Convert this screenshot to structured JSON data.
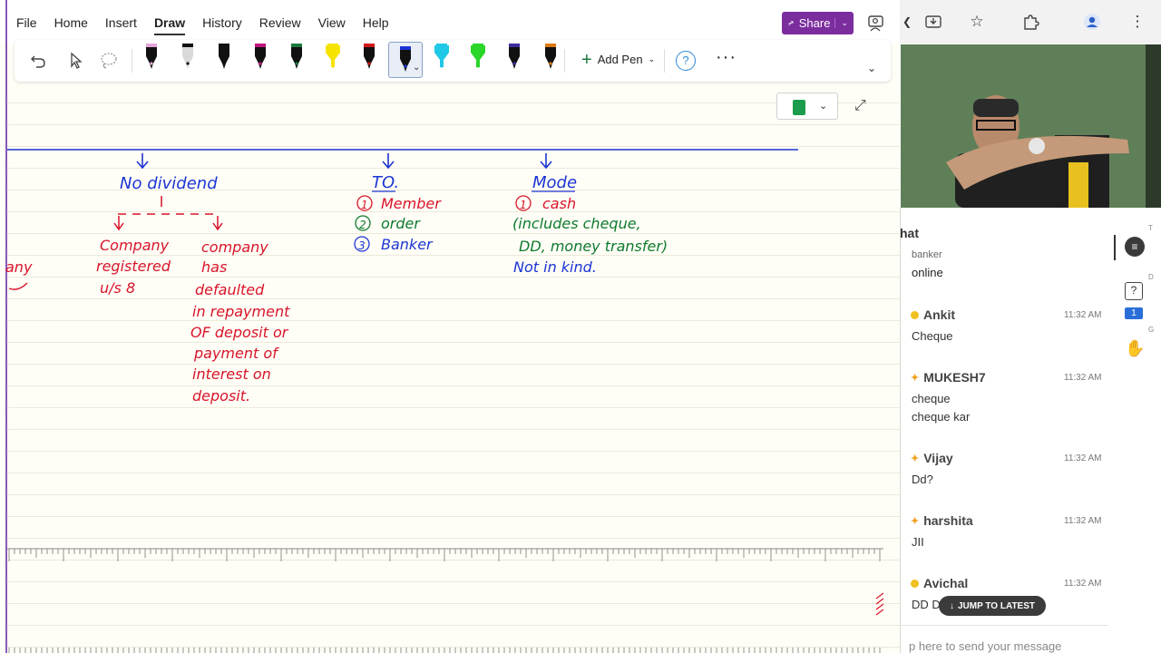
{
  "menu": {
    "items": [
      "File",
      "Home",
      "Insert",
      "Draw",
      "History",
      "Review",
      "View",
      "Help"
    ],
    "active": "Draw",
    "share_label": "Share"
  },
  "ribbon": {
    "add_pen_label": "Add Pen",
    "pens": [
      {
        "color": "#111111",
        "tip": "#e4a6d8"
      },
      {
        "color": "#d9d9d9",
        "tip": "#111111"
      },
      {
        "color": "#111111",
        "tip": "#111111"
      },
      {
        "color": "#111111",
        "tip": "#c0147e"
      },
      {
        "color": "#111111",
        "tip": "#1b7a3e"
      },
      {
        "color": "#f5e400",
        "tip": "#f5e400"
      },
      {
        "color": "#111111",
        "tip": "#d11a1a"
      },
      {
        "color": "#111111",
        "tip": "#1d35d6"
      },
      {
        "color": "#1ec8e6",
        "tip": "#1ec8e6"
      },
      {
        "color": "#2ad62a",
        "tip": "#2ad62a"
      },
      {
        "color": "#111111",
        "tip": "#3c2b9e"
      },
      {
        "color": "#111111",
        "tip": "#e07a10"
      }
    ],
    "selected_pen": 7
  },
  "colors": {
    "ink_blue": "#1c34d4",
    "ink_red": "#d8142a",
    "ink_green": "#0e7a2e",
    "share_bg": "#7b2d9e"
  },
  "notes": {
    "no_dividend": {
      "heading": "No dividend",
      "branch_1_lines": [
        "Company",
        "registered",
        "u/s 8"
      ],
      "branch_2_lines": [
        "company",
        "has",
        "defaulted",
        "in repayment",
        "OF deposit or",
        "payment of",
        "interest on",
        "deposit."
      ]
    },
    "to": {
      "heading": "TO.",
      "items": [
        {
          "num": "1",
          "text": "Member"
        },
        {
          "num": "2",
          "text": "order"
        },
        {
          "num": "3",
          "text": "Banker"
        }
      ]
    },
    "mode": {
      "heading": "Mode",
      "item_num": "1",
      "item_text": "cash",
      "include_lines": [
        "(includes cheque,",
        "DD, money transfer)"
      ],
      "not_in_kind": "Not in kind."
    },
    "left_fragment": "any"
  },
  "chat": {
    "title": "hat",
    "partial_top": "banker",
    "first_message": "online",
    "messages": [
      {
        "name": "Ankit",
        "badge": "dot",
        "time": "11:32 AM",
        "lines": [
          "Cheque"
        ]
      },
      {
        "name": "MUKESH7",
        "badge": "spark",
        "time": "11:32 AM",
        "lines": [
          "cheque",
          "cheque kar"
        ]
      },
      {
        "name": "Vijay",
        "badge": "spark",
        "time": "11:32 AM",
        "lines": [
          "Dd?"
        ]
      },
      {
        "name": "harshita",
        "badge": "spark",
        "time": "11:32 AM",
        "lines": [
          "JII"
        ]
      },
      {
        "name": "Avichal",
        "badge": "dot",
        "time": "11:32 AM",
        "lines": [
          "DD D"
        ]
      }
    ],
    "jump_label": "JUMP TO LATEST",
    "input_placeholder": "p here to send your message",
    "side_badge_count": "1",
    "side_letters": [
      "T",
      "D",
      "G"
    ]
  }
}
